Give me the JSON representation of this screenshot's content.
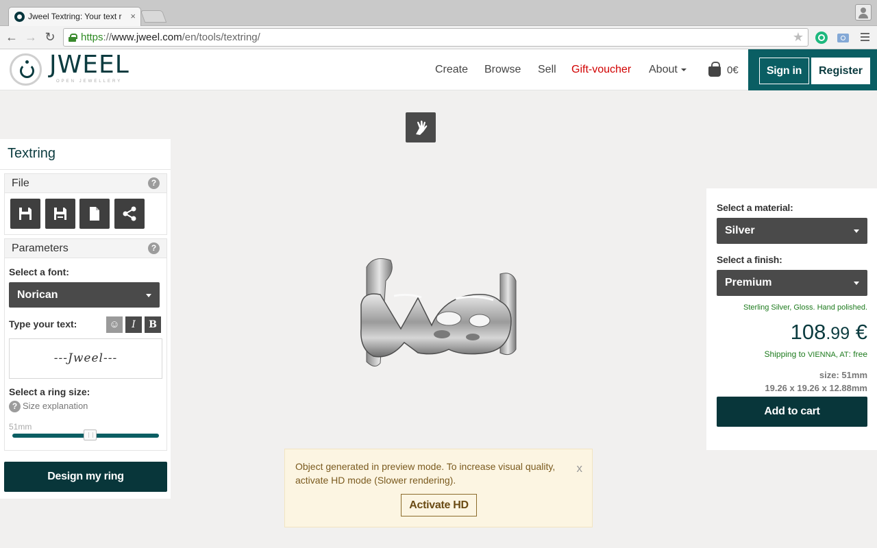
{
  "browser": {
    "tab_title": "Jweel Textring: Your text r",
    "tab_close": "×",
    "url_scheme": "https",
    "url_sep": "://",
    "url_host": "www.jweel.com",
    "url_path": "/en/tools/textring/"
  },
  "header": {
    "logo_text": "JWEEL",
    "logo_tagline": "OPEN JEWELLERY",
    "nav": {
      "create": "Create",
      "browse": "Browse",
      "sell": "Sell",
      "gift": "Gift-voucher",
      "about": "About"
    },
    "cart_total": "0€",
    "sign_in": "Sign in",
    "register": "Register"
  },
  "left_panel": {
    "title": "Textring",
    "file": {
      "title": "File",
      "help": "?"
    },
    "parameters": {
      "title": "Parameters",
      "help": "?",
      "font_label": "Select a font:",
      "font_value": "Norican",
      "text_label": "Type your text:",
      "italic": "I",
      "bold": "B",
      "text_value": "---Jweel---",
      "size_label": "Select a ring size:",
      "size_explanation_q": "?",
      "size_explanation": "Size explanation",
      "size_value": "51mm",
      "size_slider_position": 0.53
    },
    "design_button": "Design my ring"
  },
  "right_panel": {
    "material_label": "Select a material:",
    "material_value": "Silver",
    "finish_label": "Select a finish:",
    "finish_value": "Premium",
    "finish_description": "Sterling Silver, Gloss. Hand polished.",
    "price_main": "108",
    "price_decimals": ".99",
    "price_currency": "€",
    "shipping_text": "Shipping to",
    "shipping_location": "VIENNA, AT",
    "shipping_cost": ": free",
    "size": "size: 51mm",
    "dimensions": "19.26 x 19.26 x 12.88mm",
    "add_to_cart": "Add to cart"
  },
  "notice": {
    "text": "Object generated in preview mode. To increase visual quality, activate HD mode (Slower rendering).",
    "close": "x",
    "button": "Activate HD"
  },
  "preview": {
    "ring_text": "Jweel"
  },
  "colors": {
    "brand_dark": "#08363a",
    "brand_teal": "#0a5e63",
    "gift_red": "#d10000",
    "success_green": "#1c7a1c"
  }
}
